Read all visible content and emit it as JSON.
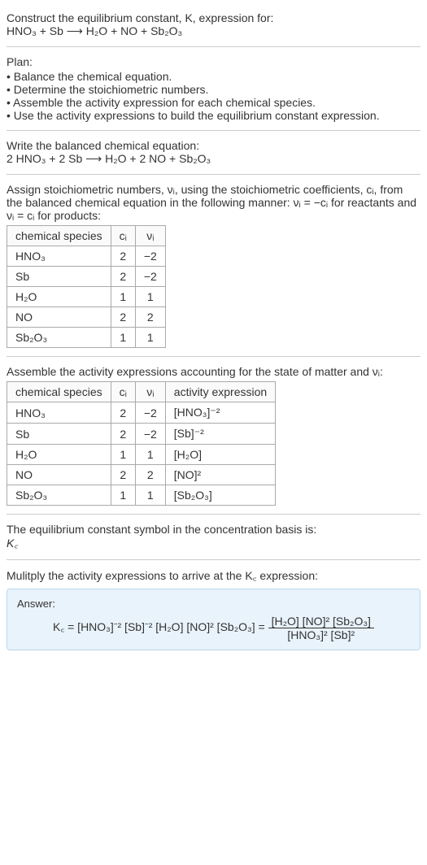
{
  "intro": {
    "line1": "Construct the equilibrium constant, K, expression for:",
    "equation": "HNO₃ + Sb ⟶ H₂O + NO + Sb₂O₃"
  },
  "plan": {
    "heading": "Plan:",
    "items": [
      "Balance the chemical equation.",
      "Determine the stoichiometric numbers.",
      "Assemble the activity expression for each chemical species.",
      "Use the activity expressions to build the equilibrium constant expression."
    ]
  },
  "balanced": {
    "heading": "Write the balanced chemical equation:",
    "equation": "2 HNO₃ + 2 Sb ⟶ H₂O + 2 NO + Sb₂O₃"
  },
  "assign": {
    "text": "Assign stoichiometric numbers, νᵢ, using the stoichiometric coefficients, cᵢ, from the balanced chemical equation in the following manner: νᵢ = −cᵢ for reactants and νᵢ = cᵢ for products:"
  },
  "table1": {
    "headers": [
      "chemical species",
      "cᵢ",
      "νᵢ"
    ],
    "rows": [
      [
        "HNO₃",
        "2",
        "−2"
      ],
      [
        "Sb",
        "2",
        "−2"
      ],
      [
        "H₂O",
        "1",
        "1"
      ],
      [
        "NO",
        "2",
        "2"
      ],
      [
        "Sb₂O₃",
        "1",
        "1"
      ]
    ]
  },
  "assemble": {
    "text": "Assemble the activity expressions accounting for the state of matter and νᵢ:"
  },
  "table2": {
    "headers": [
      "chemical species",
      "cᵢ",
      "νᵢ",
      "activity expression"
    ],
    "rows": [
      [
        "HNO₃",
        "2",
        "−2",
        "[HNO₃]⁻²"
      ],
      [
        "Sb",
        "2",
        "−2",
        "[Sb]⁻²"
      ],
      [
        "H₂O",
        "1",
        "1",
        "[H₂O]"
      ],
      [
        "NO",
        "2",
        "2",
        "[NO]²"
      ],
      [
        "Sb₂O₃",
        "1",
        "1",
        "[Sb₂O₃]"
      ]
    ]
  },
  "symbol": {
    "line1": "The equilibrium constant symbol in the concentration basis is:",
    "line2": "K꜀"
  },
  "multiply": {
    "text": "Mulitply the activity expressions to arrive at the K꜀ expression:"
  },
  "answer": {
    "label": "Answer:",
    "lhs": "K꜀ = [HNO₃]⁻² [Sb]⁻² [H₂O] [NO]² [Sb₂O₃] =",
    "frac_num": "[H₂O] [NO]² [Sb₂O₃]",
    "frac_den": "[HNO₃]² [Sb]²"
  },
  "chart_data": {
    "type": "table",
    "tables": [
      {
        "title": "Stoichiometric numbers",
        "columns": [
          "chemical species",
          "c_i",
          "ν_i"
        ],
        "rows": [
          {
            "chemical species": "HNO3",
            "c_i": 2,
            "ν_i": -2
          },
          {
            "chemical species": "Sb",
            "c_i": 2,
            "ν_i": -2
          },
          {
            "chemical species": "H2O",
            "c_i": 1,
            "ν_i": 1
          },
          {
            "chemical species": "NO",
            "c_i": 2,
            "ν_i": 2
          },
          {
            "chemical species": "Sb2O3",
            "c_i": 1,
            "ν_i": 1
          }
        ]
      },
      {
        "title": "Activity expressions",
        "columns": [
          "chemical species",
          "c_i",
          "ν_i",
          "activity expression"
        ],
        "rows": [
          {
            "chemical species": "HNO3",
            "c_i": 2,
            "ν_i": -2,
            "activity expression": "[HNO3]^-2"
          },
          {
            "chemical species": "Sb",
            "c_i": 2,
            "ν_i": -2,
            "activity expression": "[Sb]^-2"
          },
          {
            "chemical species": "H2O",
            "c_i": 1,
            "ν_i": 1,
            "activity expression": "[H2O]"
          },
          {
            "chemical species": "NO",
            "c_i": 2,
            "ν_i": 2,
            "activity expression": "[NO]^2"
          },
          {
            "chemical species": "Sb2O3",
            "c_i": 1,
            "ν_i": 1,
            "activity expression": "[Sb2O3]"
          }
        ]
      }
    ]
  }
}
